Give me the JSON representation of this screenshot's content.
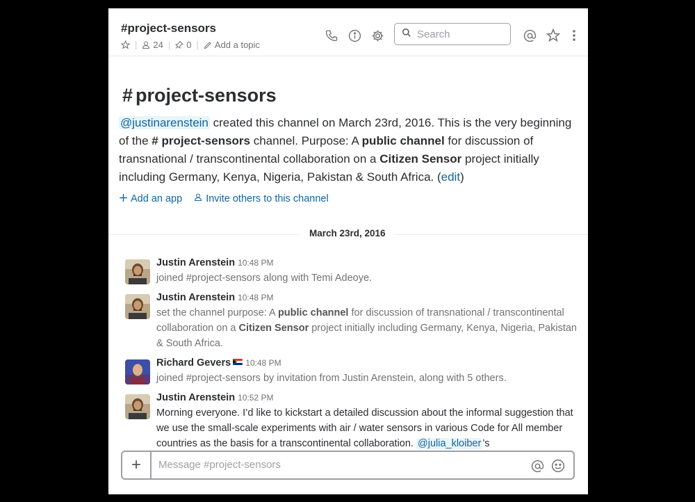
{
  "header": {
    "channel_title": "#project-sensors",
    "members_count": "24",
    "pinned_count": "0",
    "add_topic_label": "Add a topic",
    "search_placeholder": "Search"
  },
  "intro": {
    "hash": "#",
    "title": "project-sensors",
    "creator_mention": "@justinarenstein",
    "text_1": " created this channel on March 23rd, 2016. This is the very beginning of the ",
    "channel_ref": "# project-sensors",
    "text_2": " channel. Purpose: A ",
    "bold_1": "public channel",
    "text_3": " for discussion of transnational / transcontinental collaboration on a ",
    "bold_2": "Citizen Sensor",
    "text_4": " project initially including Germany, Kenya, Nigeria, Pakistan & South Africa. (",
    "edit_link": "edit",
    "text_5": ")",
    "add_app_label": "Add an app",
    "invite_label": "Invite others to this channel"
  },
  "divider_date": "March 23rd, 2016",
  "messages": [
    {
      "sender": "Justin Arenstein",
      "time": "10:48 PM",
      "text": "joined #project-sensors along with Temi Adeoye."
    },
    {
      "sender": "Justin Arenstein",
      "time": "10:48 PM",
      "text_1": "set the channel purpose: A ",
      "bold_1": "public channel",
      "text_2": " for discussion of transnational / transcontinental collaboration on a ",
      "bold_2": "Citizen Sensor",
      "text_3": " project initially including Germany, Kenya, Nigeria, Pakistan & South Africa."
    },
    {
      "sender": "Richard Gevers",
      "time": "10:48 PM",
      "text": "joined #project-sensors by invitation from Justin Arenstein, along with 5 others."
    },
    {
      "sender": "Justin Arenstein",
      "time": "10:52 PM",
      "text_1": "Morning everyone. I’d like to kickstart a detailed discussion about the informal suggestion that we use the small-scale experiments with air / water sensors in various Code for All member countries as the basis for a transcontinental collaboration. ",
      "mention": "@julia_kloiber",
      "text_2": "’s"
    }
  ],
  "composer": {
    "placeholder": "Message #project-sensors",
    "plus_label": "+"
  },
  "colors": {
    "link": "#1264a3",
    "mention_bg": "#e8f5fa",
    "text": "#2c2d30",
    "muted": "#717274"
  }
}
